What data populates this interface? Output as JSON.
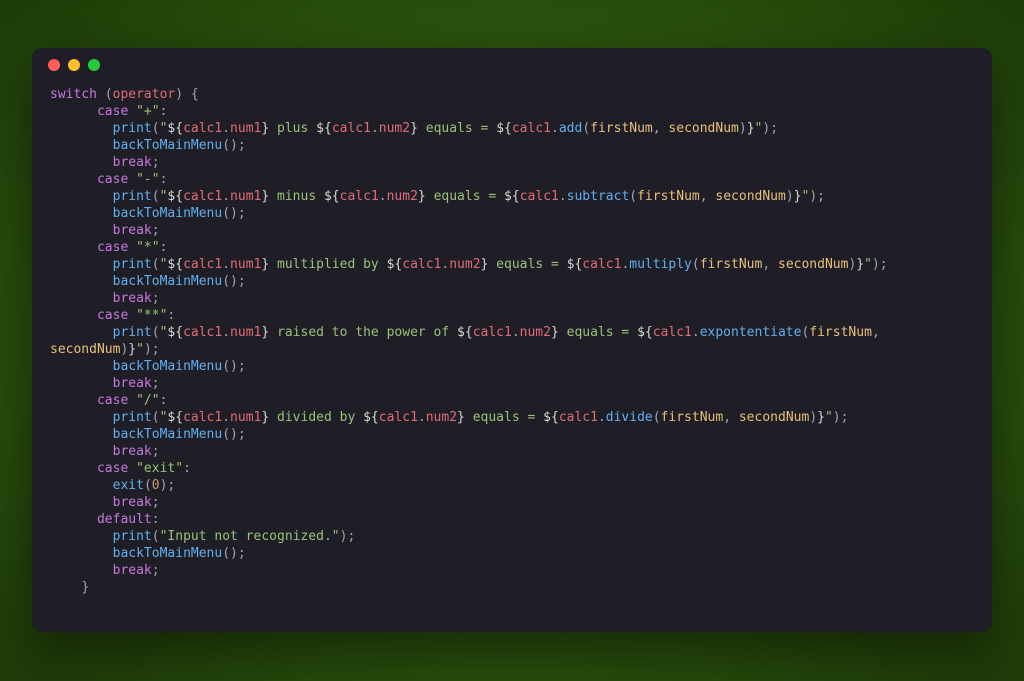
{
  "colors": {
    "kw": "#c678dd",
    "fn": "#61afef",
    "prop": "#e06c75",
    "str": "#98c379",
    "num": "#d19a66",
    "arg": "#e5c07b",
    "pun": "#9da5b4",
    "card_bg": "#1f1e26"
  },
  "tokens": {
    "kw_switch": "switch",
    "kw_case": "case",
    "kw_break": "break",
    "kw_default": "default",
    "id_operator": "operator",
    "case_plus": "\"+\"",
    "case_minus": "\"-\"",
    "case_mul": "\"*\"",
    "case_pow": "\"**\"",
    "case_div": "\"/\"",
    "case_exit": "\"exit\"",
    "fn_print": "print",
    "fn_backToMainMenu": "backToMainMenu",
    "fn_exit": "exit",
    "fn_add": "add",
    "fn_subtract": "subtract",
    "fn_multiply": "multiply",
    "fn_exponentiate": "expontentiate",
    "fn_divide": "divide",
    "obj_calc1": "calc1",
    "prop_num1": "num1",
    "prop_num2": "num2",
    "arg_firstNum": "firstNum",
    "arg_secondNum": "secondNum",
    "txt_plus": " plus ",
    "txt_minus": " minus ",
    "txt_multiplied_by": " multiplied by ",
    "txt_raised_to_power": " raised to the power of ",
    "txt_divided_by": " divided by ",
    "txt_equals": " equals = ",
    "str_input_not_recognized": "\"Input not recognized.\"",
    "num_zero": "0",
    "dollar_open": "${",
    "brace_close": "}",
    "quote": "\"",
    "lparen": "(",
    "rparen": ")",
    "comma": ", ",
    "colon": ":",
    "semicolon": ";",
    "dot": ".",
    "obrace": "{",
    "cbrace": "}",
    "sp": " "
  },
  "chart_data": null
}
